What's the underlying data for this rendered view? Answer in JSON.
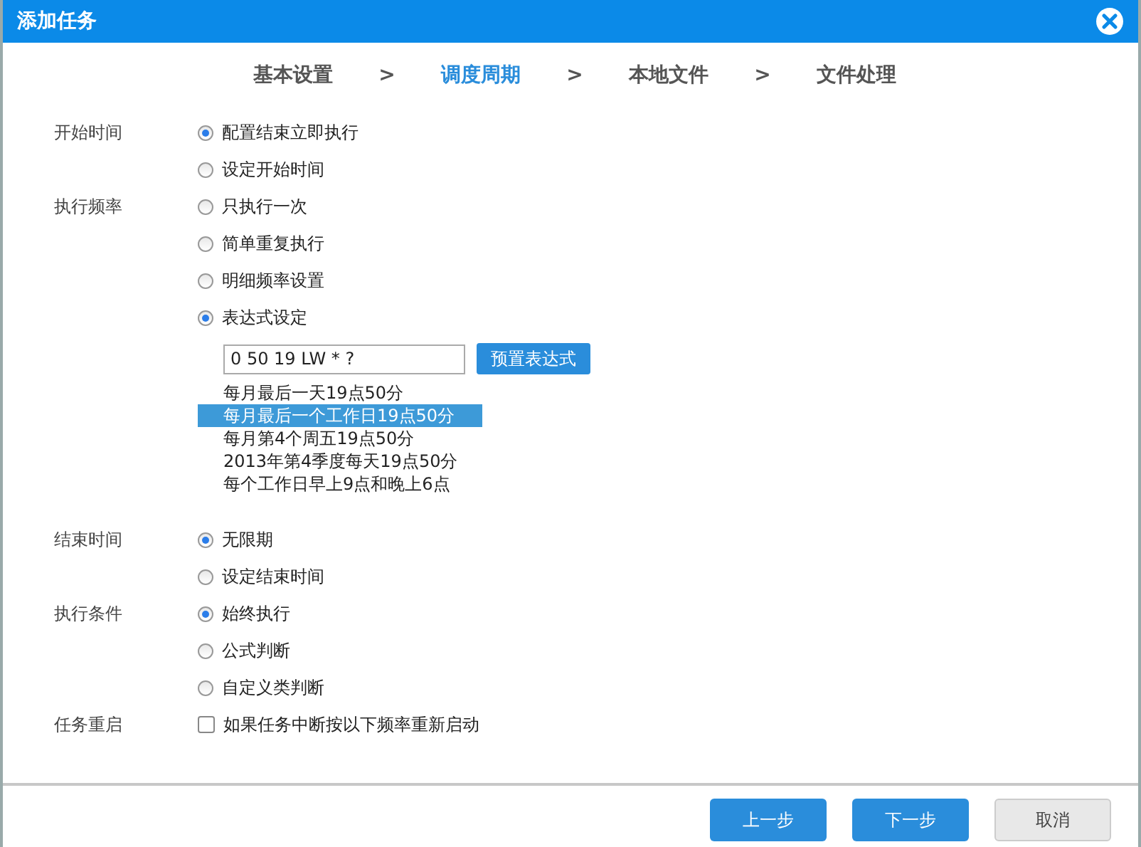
{
  "window": {
    "title": "添加任务"
  },
  "steps": [
    {
      "kind": "step",
      "label": "基本设置",
      "selected": false
    },
    {
      "kind": "separator",
      "label": ">"
    },
    {
      "kind": "step",
      "label": "调度周期",
      "selected": true
    },
    {
      "kind": "separator",
      "label": ">"
    },
    {
      "kind": "step",
      "label": "本地文件",
      "selected": false
    },
    {
      "kind": "separator",
      "label": ">"
    },
    {
      "kind": "step",
      "label": "文件处理",
      "selected": false
    }
  ],
  "sections": [
    {
      "label": "开始时间",
      "kind": "radio",
      "options": [
        {
          "label": "配置结束立即执行",
          "selected": true
        },
        {
          "label": "设定开始时间",
          "selected": false
        }
      ]
    },
    {
      "label": "执行频率",
      "kind": "radio",
      "options": [
        {
          "label": "只执行一次",
          "selected": false
        },
        {
          "label": "简单重复执行",
          "selected": false
        },
        {
          "label": "明细频率设置",
          "selected": false
        },
        {
          "label": "表达式设定",
          "selected": true
        }
      ],
      "expression": {
        "value": "0 50 19 LW * ?",
        "button": "预置表达式",
        "presets": [
          {
            "text": "每月最后一天19点50分",
            "selected": false
          },
          {
            "text": "每月最后一个工作日19点50分",
            "selected": true
          },
          {
            "text": "每月第4个周五19点50分",
            "selected": false
          },
          {
            "text": "2013年第4季度每天19点50分",
            "selected": false
          },
          {
            "text": "每个工作日早上9点和晚上6点",
            "selected": false
          }
        ]
      }
    },
    {
      "label": "结束时间",
      "kind": "radio",
      "options": [
        {
          "label": "无限期",
          "selected": true
        },
        {
          "label": "设定结束时间",
          "selected": false
        }
      ]
    },
    {
      "label": "执行条件",
      "kind": "radio",
      "options": [
        {
          "label": "始终执行",
          "selected": true
        },
        {
          "label": "公式判断",
          "selected": false
        },
        {
          "label": "自定义类判断",
          "selected": false
        }
      ]
    },
    {
      "label": "任务重启",
      "kind": "checkbox",
      "options": [
        {
          "label": "如果任务中断按以下频率重新启动",
          "checked": false
        }
      ]
    }
  ],
  "buttons": [
    {
      "label": "上一步",
      "kind": "primary"
    },
    {
      "label": "下一步",
      "kind": "primary"
    },
    {
      "label": "取消",
      "kind": "secondary"
    }
  ]
}
